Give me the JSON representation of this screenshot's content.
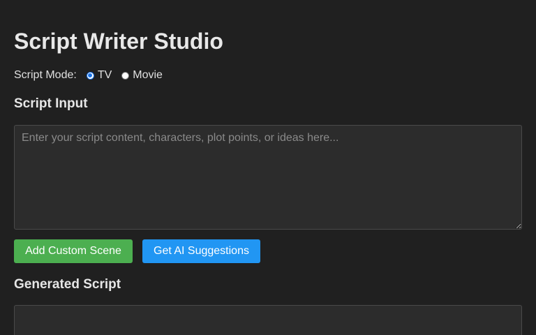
{
  "app": {
    "title": "Script Writer Studio"
  },
  "mode": {
    "label": "Script Mode:",
    "options": [
      {
        "label": "TV",
        "checked": true
      },
      {
        "label": "Movie",
        "checked": false
      }
    ]
  },
  "input_section": {
    "heading": "Script Input",
    "placeholder": "Enter your script content, characters, plot points, or ideas here...",
    "value": ""
  },
  "actions": {
    "add_scene_label": "Add Custom Scene",
    "ai_suggest_label": "Get AI Suggestions",
    "add_scene_color": "#4caf50",
    "ai_suggest_color": "#2196f3"
  },
  "output_section": {
    "heading": "Generated Script",
    "value": ""
  }
}
